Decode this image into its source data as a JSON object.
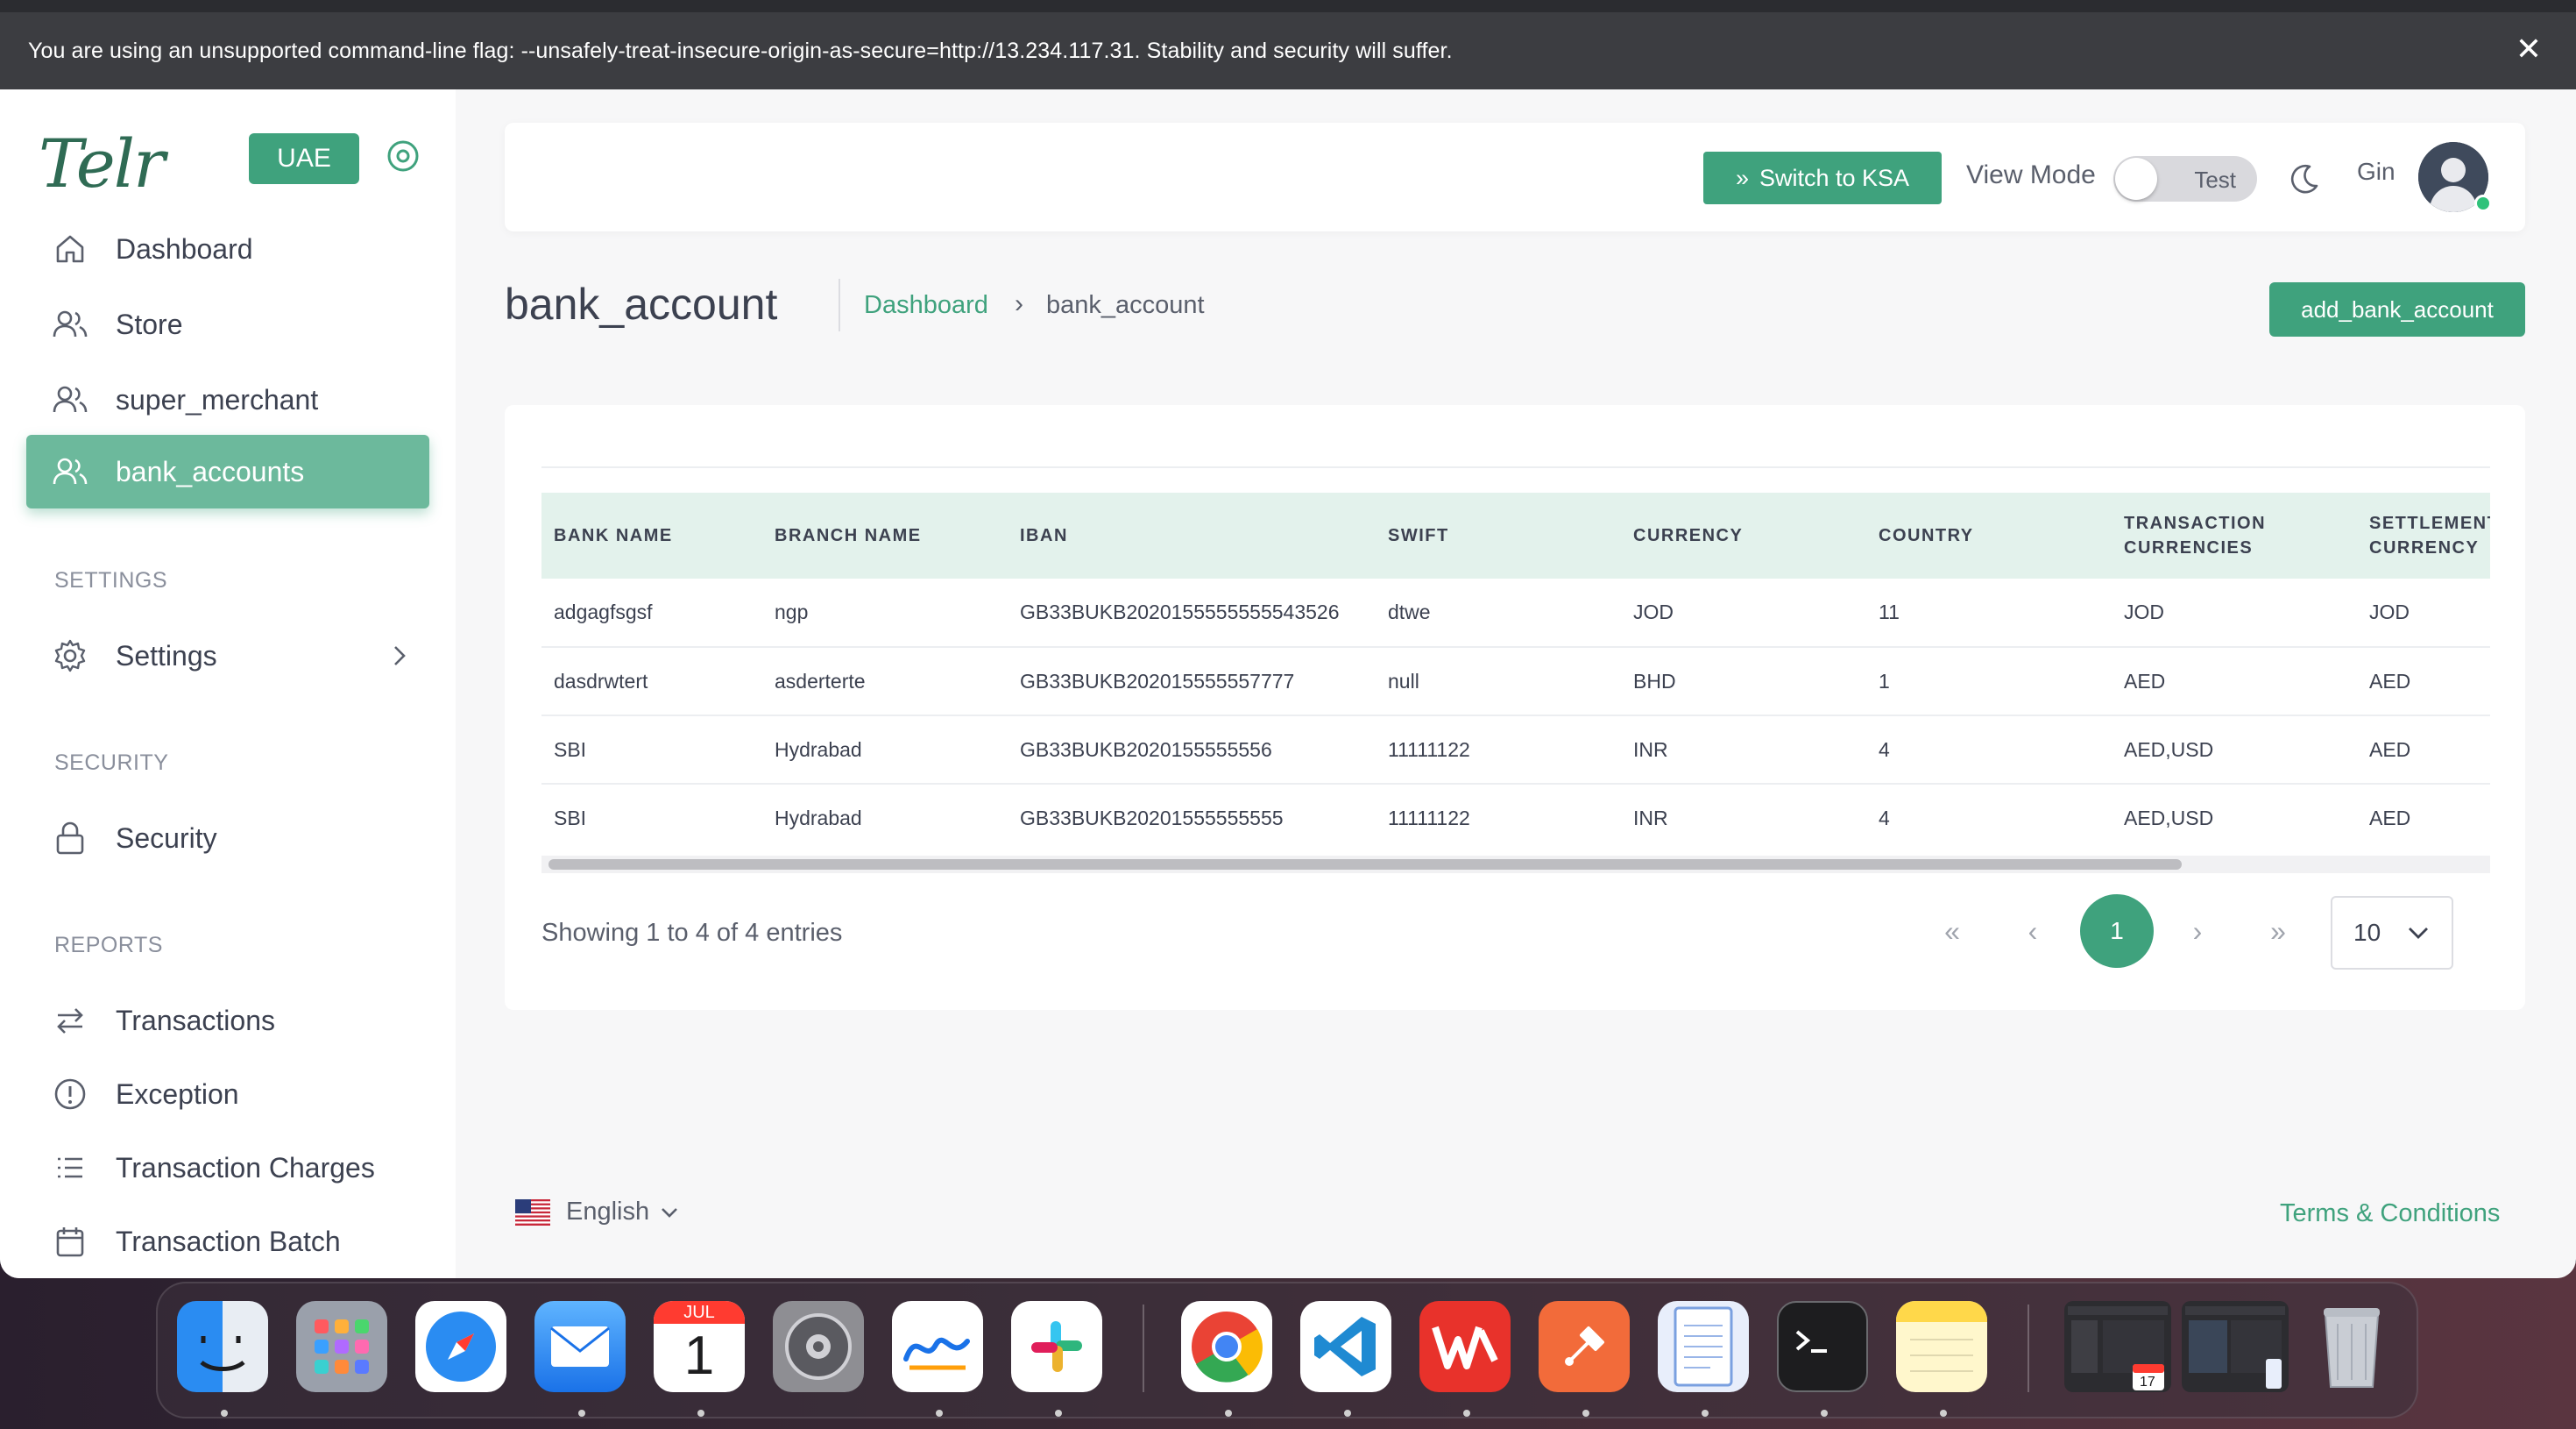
{
  "browser": {
    "warning": "You are using an unsupported command-line flag: --unsafely-treat-insecure-origin-as-secure=http://13.234.117.31. Stability and security will suffer.",
    "close_glyph": "✕"
  },
  "sidebar": {
    "logo": "Telr",
    "region": "UAE",
    "items": [
      {
        "label": "Dashboard",
        "icon": "home-icon"
      },
      {
        "label": "Store",
        "icon": "users-icon"
      },
      {
        "label": "super_merchant",
        "icon": "users-icon"
      },
      {
        "label": "bank_accounts",
        "icon": "users-icon",
        "active": true
      }
    ],
    "sections": {
      "settings": "SETTINGS",
      "security": "SECURITY",
      "reports": "REPORTS"
    },
    "settings_item": "Settings",
    "security_item": "Security",
    "report_items": [
      "Transactions",
      "Exception",
      "Transaction Charges",
      "Transaction Batch"
    ]
  },
  "header": {
    "switch_button": "Switch to KSA",
    "switch_prefix": "»",
    "view_mode_label": "View Mode",
    "view_mode_value": "Test",
    "user_name": "Gin"
  },
  "page": {
    "title": "bank_account",
    "breadcrumb_home": "Dashboard",
    "breadcrumb_sep": "›",
    "breadcrumb_current": "bank_account",
    "add_button": "add_bank_account"
  },
  "table": {
    "columns": [
      "BANK NAME",
      "BRANCH NAME",
      "IBAN",
      "SWIFT",
      "CURRENCY",
      "COUNTRY",
      "TRANSACTION CURRENCIES",
      "SETTLEMENT CURRENCY"
    ],
    "rows": [
      [
        "adgagfsgsf",
        "ngp",
        "GB33BUKB2020155555555543526",
        "dtwe",
        "JOD",
        "11",
        "JOD",
        "JOD"
      ],
      [
        "dasdrwtert",
        "asderterte",
        "GB33BUKB202015555557777",
        "null",
        "BHD",
        "1",
        "AED",
        "AED"
      ],
      [
        "SBI",
        "Hydrabad",
        "GB33BUKB2020155555556",
        "11111122",
        "INR",
        "4",
        "AED,USD",
        "AED"
      ],
      [
        "SBI",
        "Hydrabad",
        "GB33BUKB20201555555555",
        "11111122",
        "INR",
        "4",
        "AED,USD",
        "AED"
      ]
    ],
    "entries_text": "Showing 1 to 4 of 4 entries",
    "pager": {
      "first": "«",
      "prev": "‹",
      "current": "1",
      "next": "›",
      "last": "»"
    },
    "page_size": "10"
  },
  "footer": {
    "language": "English",
    "terms": "Terms & Conditions"
  },
  "dock": {
    "calendar_month": "JUL",
    "calendar_day": "1",
    "mini_calendar_day": "17"
  },
  "colors": {
    "accent": "#3fa27d",
    "sidebar_active": "#6cb99c",
    "table_header": "#e3f2ec"
  }
}
